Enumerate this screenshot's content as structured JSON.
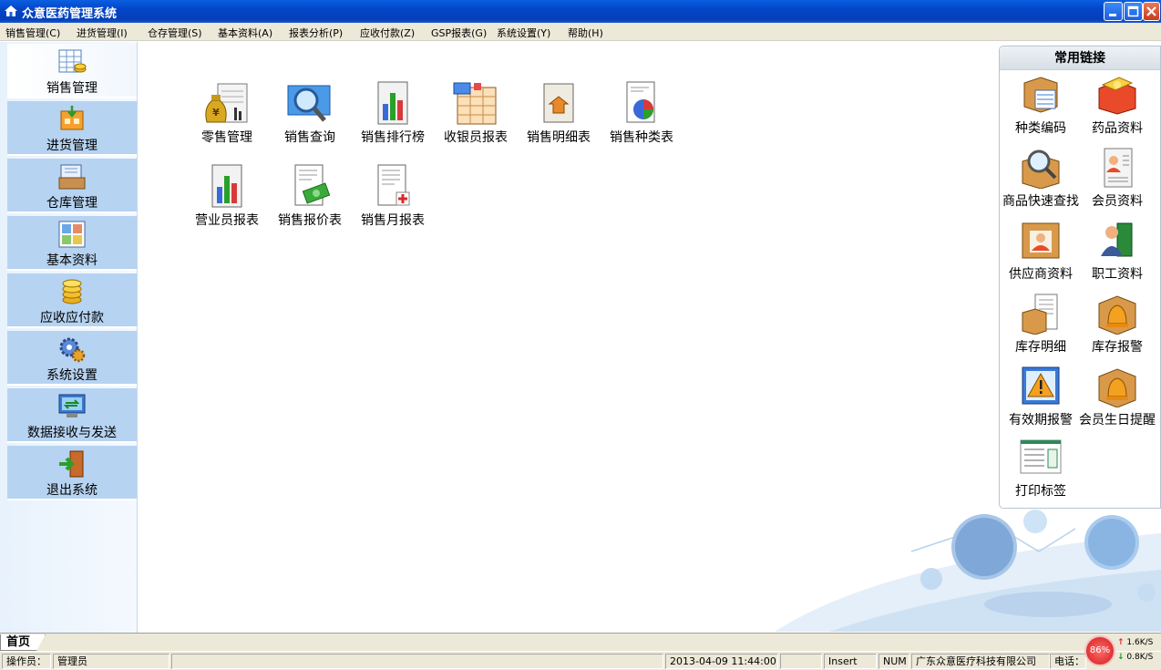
{
  "window": {
    "title": "众意医药管理系统"
  },
  "menu": [
    "销售管理(C)",
    "进货管理(I)",
    "仓存管理(S)",
    "基本资料(A)",
    "报表分析(P)",
    "应收付款(Z)",
    "GSP报表(G)",
    "系统设置(Y)",
    "帮助(H)"
  ],
  "nav": [
    {
      "label": "销售管理",
      "icon": "sales-table-icon"
    },
    {
      "label": "进货管理",
      "icon": "purchase-box-icon"
    },
    {
      "label": "仓库管理",
      "icon": "warehouse-icon"
    },
    {
      "label": "基本资料",
      "icon": "basic-data-icon"
    },
    {
      "label": "应收应付款",
      "icon": "coins-icon"
    },
    {
      "label": "系统设置",
      "icon": "gears-icon"
    },
    {
      "label": "数据接收与发送",
      "icon": "data-transfer-icon"
    },
    {
      "label": "退出系统",
      "icon": "exit-door-icon"
    }
  ],
  "tiles": [
    {
      "label": "零售管理",
      "icon": "retail-moneybag-icon"
    },
    {
      "label": "销售查询",
      "icon": "magnifier-icon"
    },
    {
      "label": "销售排行榜",
      "icon": "bar-chart-icon"
    },
    {
      "label": "收银员报表",
      "icon": "cashier-report-icon"
    },
    {
      "label": "销售明细表",
      "icon": "sales-detail-icon"
    },
    {
      "label": "销售种类表",
      "icon": "pie-report-icon"
    },
    {
      "label": "营业员报表",
      "icon": "bar-chart-icon"
    },
    {
      "label": "销售报价表",
      "icon": "quote-money-icon"
    },
    {
      "label": "销售月报表",
      "icon": "monthly-report-icon"
    }
  ],
  "quick_links": {
    "title": "常用链接",
    "items": [
      {
        "label": "种类编码",
        "icon": "category-box-icon"
      },
      {
        "label": "药品资料",
        "icon": "medicine-box-icon"
      },
      {
        "label": "商品快速查找",
        "icon": "search-box-icon"
      },
      {
        "label": "会员资料",
        "icon": "member-card-icon"
      },
      {
        "label": "供应商资料",
        "icon": "supplier-icon"
      },
      {
        "label": "职工资料",
        "icon": "staff-icon"
      },
      {
        "label": "库存明细",
        "icon": "stock-detail-icon"
      },
      {
        "label": "库存报警",
        "icon": "stock-alarm-bell-icon"
      },
      {
        "label": "有效期报警",
        "icon": "expiry-warning-icon"
      },
      {
        "label": "会员生日提醒",
        "icon": "birthday-bell-icon"
      },
      {
        "label": "打印标签",
        "icon": "print-label-icon"
      }
    ]
  },
  "tabs": [
    {
      "label": "首页"
    }
  ],
  "status": {
    "operator_label": "操作员：",
    "operator": "管理员",
    "datetime": "2013-04-09 11:44:00",
    "insert": "Insert",
    "num": "NUM",
    "company": "广东众意医疗科技有限公司",
    "phone_label": "电话："
  },
  "netmon": {
    "percent": "86%",
    "up": "1.6K/S",
    "down": "0.8K/S"
  },
  "colors": {
    "titlebar": "#0445c8",
    "nav_bg": "#b6d3f1",
    "menubar": "#ece9d8"
  }
}
